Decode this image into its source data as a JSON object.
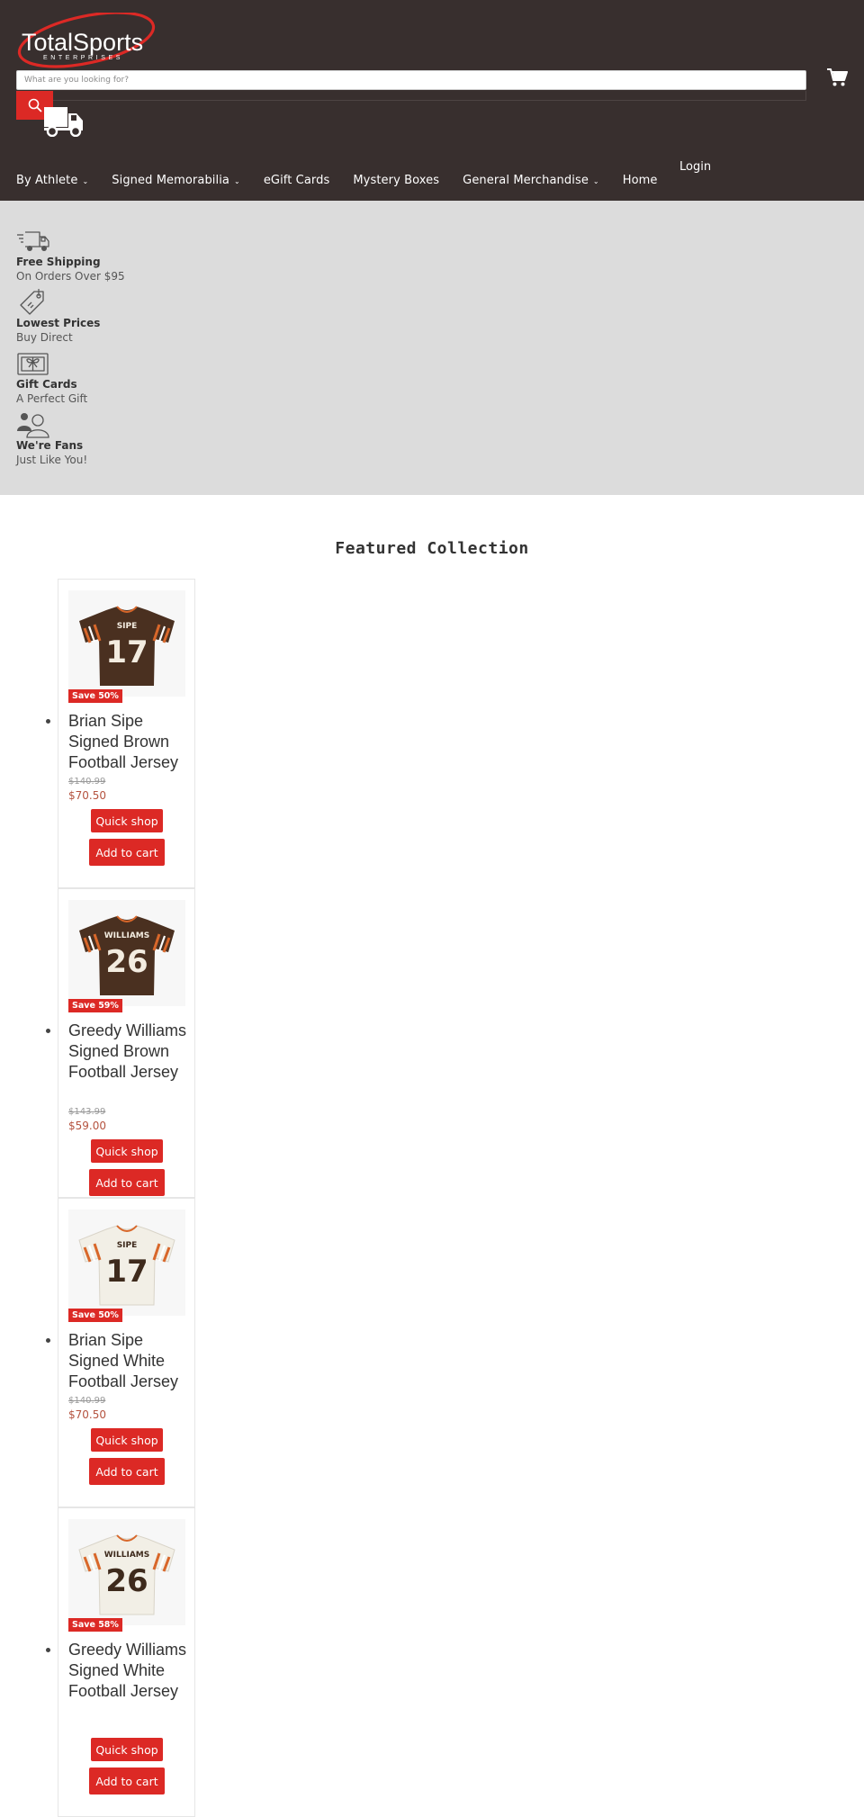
{
  "brand": {
    "logo_name": "TotalSports",
    "logo_tagline": "ENTERPRISES"
  },
  "search": {
    "placeholder": "What are you looking for?",
    "button_icon": "search-icon"
  },
  "header_icons": {
    "cart": "cart-icon",
    "truck": "truck-icon"
  },
  "nav": {
    "items": [
      {
        "label": "By Athlete",
        "has_dropdown": true
      },
      {
        "label": "Signed Memorabilia",
        "has_dropdown": true
      },
      {
        "label": "eGift Cards",
        "has_dropdown": false
      },
      {
        "label": "Mystery Boxes",
        "has_dropdown": false
      },
      {
        "label": "General Merchandise",
        "has_dropdown": true
      },
      {
        "label": "Home",
        "has_dropdown": false
      }
    ],
    "caret": "⌄",
    "login": "Login"
  },
  "features": [
    {
      "icon": "shipping-truck-icon",
      "title": "Free Shipping",
      "subtitle": "On Orders Over $95"
    },
    {
      "icon": "price-tag-icon",
      "title": "Lowest Prices",
      "subtitle": "Buy Direct"
    },
    {
      "icon": "gift-card-icon",
      "title": "Gift Cards",
      "subtitle": "A Perfect Gift"
    },
    {
      "icon": "fans-icon",
      "title": "We're Fans",
      "subtitle": "Just Like You!"
    }
  ],
  "featured": {
    "title": "Featured Collection",
    "products": [
      {
        "title": "Brian Sipe Signed Brown Football Jersey",
        "badge": "Save 50%",
        "compare_price": "$140.99",
        "price": "$70.50",
        "quick_shop": "Quick shop",
        "add_to_cart": "Add to cart",
        "jersey_color": "#4a3020",
        "number_color": "#f3ece0",
        "name_on_jersey": "SIPE",
        "number": "17"
      },
      {
        "title": "Greedy Williams Signed Brown Football Jersey",
        "badge": "Save 59%",
        "compare_price": "$143.99",
        "price": "$59.00",
        "quick_shop": "Quick shop",
        "add_to_cart": "Add to cart",
        "jersey_color": "#4a3020",
        "number_color": "#f3ece0",
        "name_on_jersey": "WILLIAMS",
        "number": "26"
      },
      {
        "title": "Brian Sipe Signed White Football Jersey",
        "badge": "Save 50%",
        "compare_price": "$140.99",
        "price": "$70.50",
        "quick_shop": "Quick shop",
        "add_to_cart": "Add to cart",
        "jersey_color": "#f2efe6",
        "number_color": "#3e2a1c",
        "name_on_jersey": "SIPE",
        "number": "17"
      },
      {
        "title": "Greedy Williams Signed White Football Jersey",
        "badge": "Save 58%",
        "compare_price": "",
        "price": "",
        "quick_shop": "Quick shop",
        "add_to_cart": "Add to cart",
        "jersey_color": "#f2efe6",
        "number_color": "#3e2a1c",
        "name_on_jersey": "WILLIAMS",
        "number": "26"
      }
    ]
  },
  "colors": {
    "header_bg": "#382f2e",
    "accent_red": "#dc2925",
    "features_bg": "#dcdcdc",
    "sale_price": "#b5533f",
    "stripe_orange": "#d8672a"
  }
}
